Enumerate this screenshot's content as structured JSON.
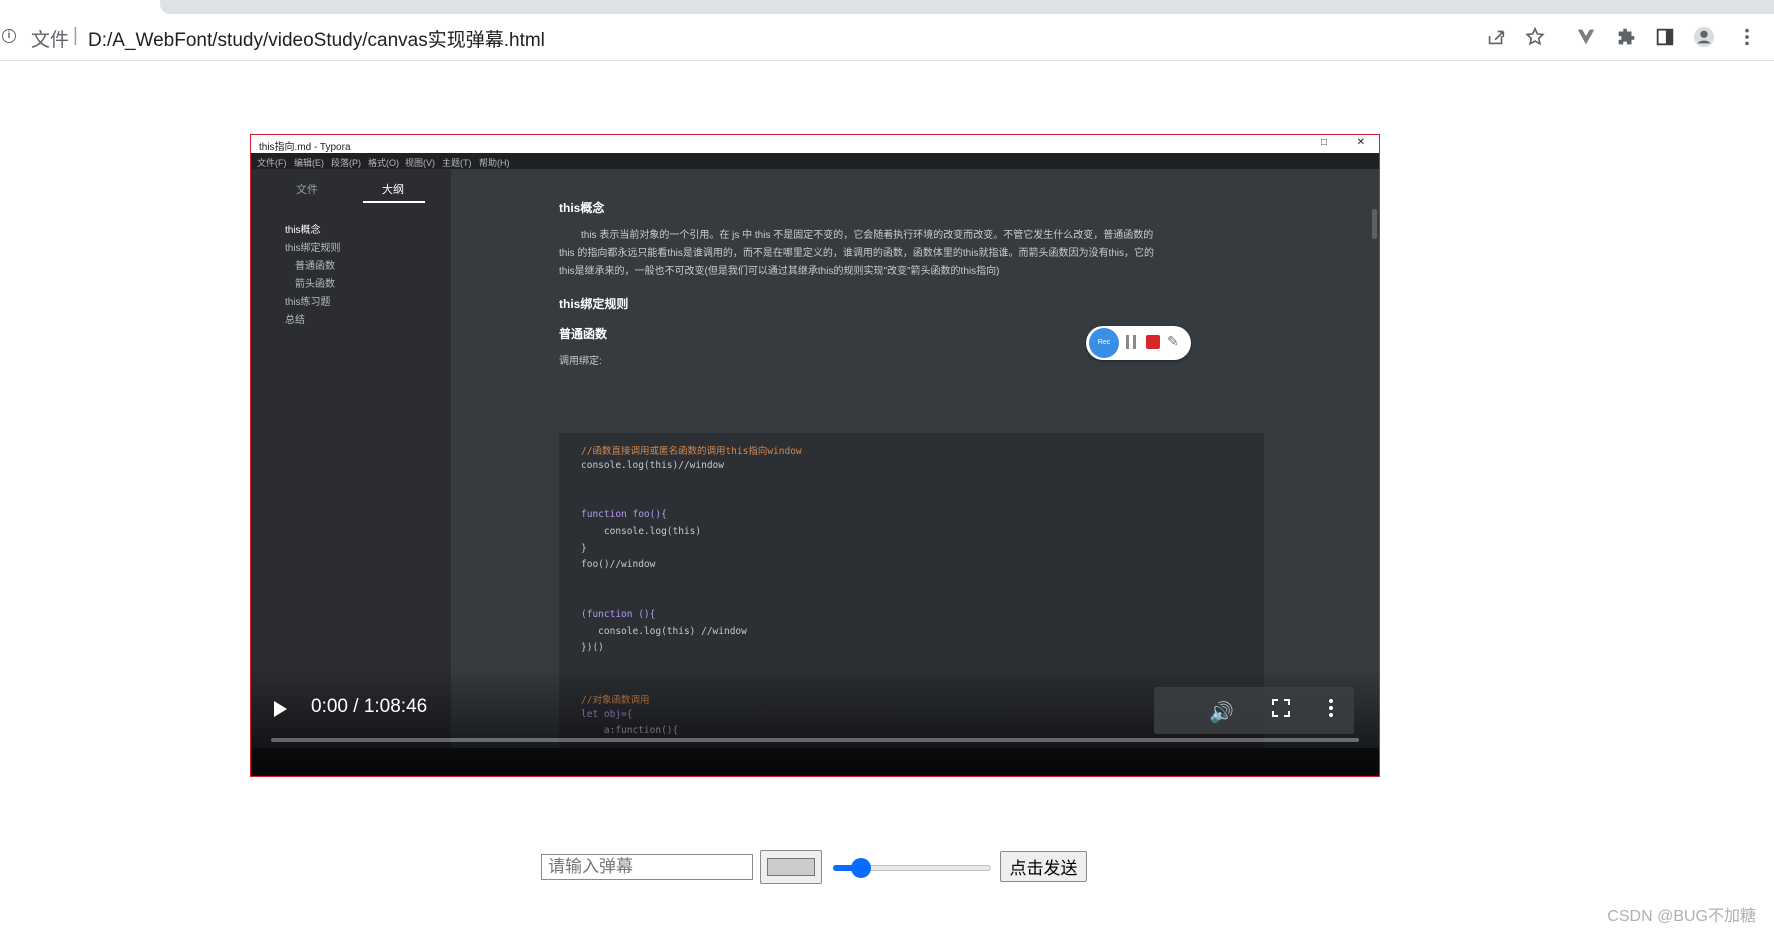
{
  "browser": {
    "file_label": "文件",
    "separator": "|",
    "url": "D:/A_WebFont/study/videoStudy/canvas实现弹幕.html",
    "toolbar_icons": [
      "share-icon",
      "star-icon",
      "vue-devtools-icon",
      "extensions-icon",
      "side-panel-icon",
      "profile-icon",
      "menu-icon"
    ]
  },
  "video": {
    "current_time": "0:00",
    "duration": "1:08:46",
    "time_display": "0:00 / 1:08:46",
    "progress": 0,
    "recorded_screen": {
      "window_title": "this指向.md - Typora",
      "menu": [
        "文件(F)",
        "编辑(E)",
        "段落(P)",
        "格式(O)",
        "视图(V)",
        "主题(T)",
        "帮助(H)"
      ],
      "sidebar_tabs": [
        "文件",
        "大纲"
      ],
      "active_tab": "大纲",
      "outline": [
        "this概念",
        "this绑定规则",
        "普通函数",
        "箭头函数",
        "this练习题",
        "总结"
      ],
      "heading_1": "this概念",
      "paragraph": [
        "this 表示当前对象的一个引用。在 js 中 this 不是固定不变的，它会随着执行环境的改变而改变。不管它发生什么改变，普通函数的",
        "this 的指向都永远只能看this是谁调用的，而不是在哪里定义的，谁调用的函数，函数体里的this就指谁。而箭头函数因为没有this，它的",
        "this是继承来的，一般也不可改变(但是我们可以通过其继承this的规则实现\"改变\"箭头函数的this指向)"
      ],
      "heading_2": "this绑定规则",
      "heading_3": "普通函数",
      "label": "调用绑定:",
      "code": [
        {
          "text": "//函数直接调用或匿名函数的调用this指向window",
          "cls": "c-comment"
        },
        {
          "text": "console.log(this)//window",
          "cls": "c-txt"
        },
        {
          "text": "",
          "cls": "c-txt"
        },
        {
          "text": "",
          "cls": "c-txt"
        },
        {
          "text": "function foo(){",
          "cls": "c-kw"
        },
        {
          "text": "    console.log(this)",
          "cls": "c-txt"
        },
        {
          "text": "}",
          "cls": "c-txt"
        },
        {
          "text": "foo()//window",
          "cls": "c-txt"
        },
        {
          "text": "",
          "cls": "c-txt"
        },
        {
          "text": "",
          "cls": "c-txt"
        },
        {
          "text": "(function (){",
          "cls": "c-kw"
        },
        {
          "text": "   console.log(this) //window",
          "cls": "c-txt"
        },
        {
          "text": "})()",
          "cls": "c-txt"
        },
        {
          "text": "",
          "cls": "c-txt"
        },
        {
          "text": "",
          "cls": "c-txt"
        },
        {
          "text": "//对象函数调用",
          "cls": "c-comment"
        },
        {
          "text": "let obj={",
          "cls": "c-kw"
        },
        {
          "text": "    a:function(){",
          "cls": "c-txt"
        }
      ],
      "rec_label": "Rec"
    }
  },
  "form": {
    "input_placeholder": "请输入弹幕",
    "input_value": "",
    "color_value": "#cccccc",
    "slider_value": 0.18,
    "send_label": "点击发送"
  },
  "watermark": "CSDN @BUG不加糖"
}
